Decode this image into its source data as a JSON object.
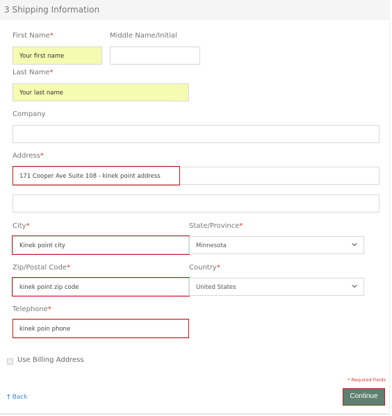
{
  "header": {
    "title": "3 Shipping Information"
  },
  "form": {
    "first_name": {
      "label": "First Name",
      "required": "*",
      "placeholder": "Your first name",
      "value": ""
    },
    "middle_name": {
      "label": "Middle Name/Initial",
      "value": ""
    },
    "last_name": {
      "label": "Last Name",
      "required": "*",
      "placeholder": "Your last name",
      "value": ""
    },
    "company": {
      "label": "Company",
      "value": ""
    },
    "address": {
      "label": "Address",
      "required": "*",
      "line1": "171 Cooper Ave Suite 108 - kinek point address",
      "line2": ""
    },
    "city": {
      "label": "City",
      "required": "*",
      "value": "Kinek point city"
    },
    "state": {
      "label": "State/Province",
      "required": "*",
      "selected": "Minnesota"
    },
    "zip": {
      "label": "Zip/Postal Code",
      "required": "*",
      "value": "kinek point zip code"
    },
    "country": {
      "label": "Country",
      "required": "*",
      "selected": "United States"
    },
    "telephone": {
      "label": "Telephone",
      "required": "*",
      "value": "kinek poin phone"
    },
    "use_billing": {
      "label": "Use Billing Address",
      "checked": false
    }
  },
  "footer": {
    "required_note": "* Required Fields",
    "back_icon": "arrow-up-icon",
    "back_label": "Back",
    "continue_label": "Continue"
  },
  "colors": {
    "required": "#e0302c",
    "highlight": "#c8161d",
    "autofill": "#f5fbb0",
    "continue_bg": "#5f7f72",
    "link": "#3d8bd4"
  }
}
